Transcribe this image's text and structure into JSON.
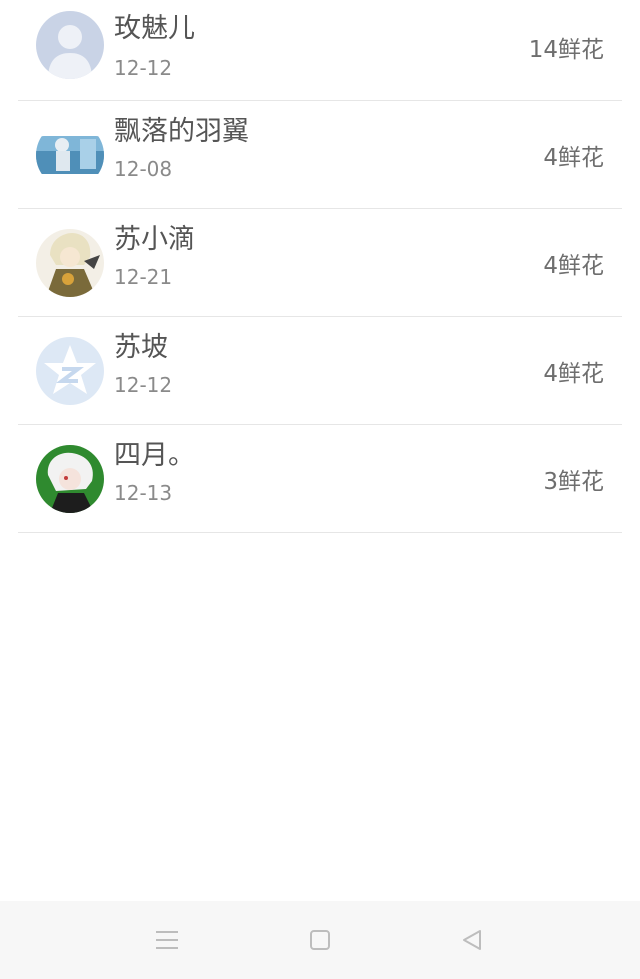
{
  "list": {
    "items": [
      {
        "name": "玫魅儿",
        "date": "12-12",
        "flowers": "14鲜花",
        "avatar": "default-user-avatar"
      },
      {
        "name": "飘落的羽翼",
        "date": "12-08",
        "flowers": "4鲜花",
        "avatar": "photo-avatar"
      },
      {
        "name": "苏小滴",
        "date": "12-21",
        "flowers": "4鲜花",
        "avatar": "anime-avatar"
      },
      {
        "name": "苏坡",
        "date": "12-12",
        "flowers": "4鲜花",
        "avatar": "star-logo-avatar"
      },
      {
        "name": "四月。",
        "date": "12-13",
        "flowers": "3鲜花",
        "avatar": "anime-green-avatar"
      }
    ]
  },
  "navbar": {
    "menu_icon": "menu-icon",
    "home_icon": "home-icon",
    "back_icon": "back-icon"
  }
}
